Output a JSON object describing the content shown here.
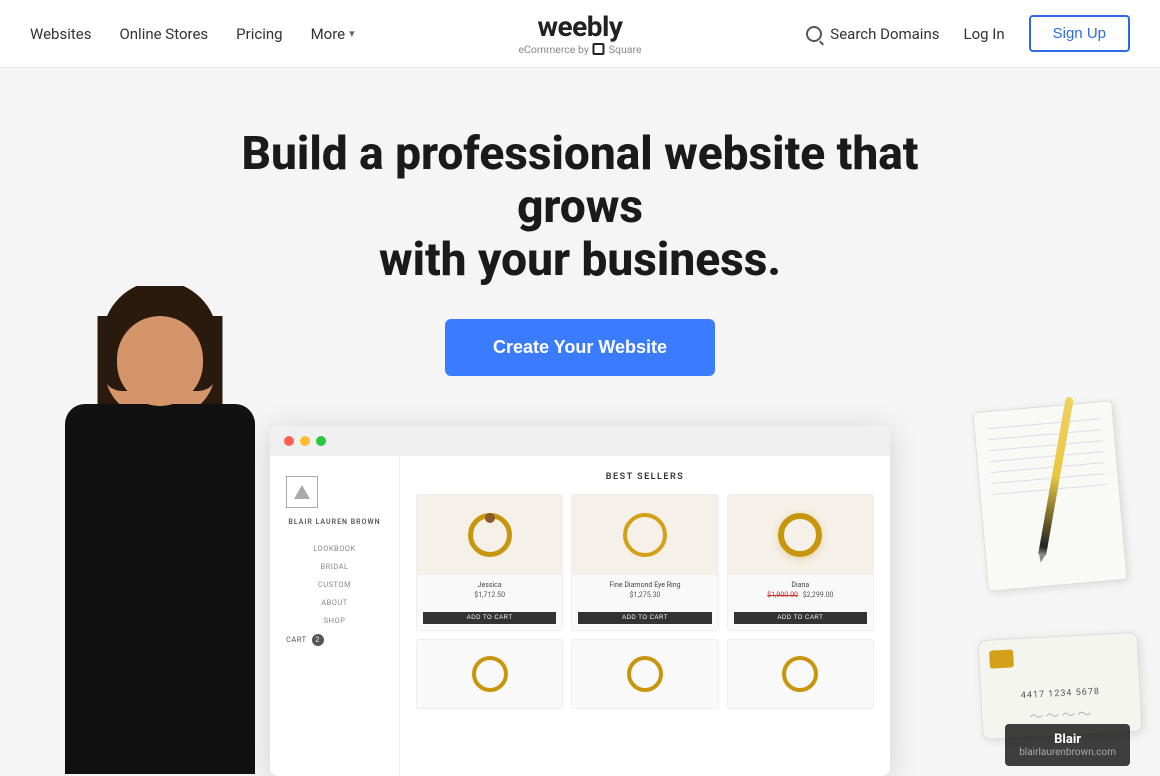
{
  "header": {
    "nav": {
      "websites": "Websites",
      "online_stores": "Online Stores",
      "pricing": "Pricing",
      "more": "More",
      "search_domains": "Search Domains",
      "login": "Log In",
      "signup": "Sign Up"
    },
    "logo": {
      "name": "weebly",
      "sub": "eCommerce by",
      "square": "Square"
    }
  },
  "hero": {
    "headline_line1": "Build a professional website that grows",
    "headline_line2": "with your business.",
    "cta": "Create Your Website"
  },
  "mockup": {
    "titlebar_dots": [
      "red",
      "yellow",
      "green"
    ],
    "sidebar": {
      "brand": "Blair Lauren Brown",
      "nav_items": [
        "Lookbook",
        "Bridal",
        "Custom",
        "About",
        "Shop"
      ],
      "cart": "Cart",
      "cart_count": "2"
    },
    "best_sellers_label": "Best Sellers",
    "products": [
      {
        "name": "Jessica",
        "price": "$1,712.50",
        "btn": "Add to Cart"
      },
      {
        "name": "Fine Diamond Eye Ring",
        "price": "$1,275.30",
        "btn": "Add to Cart"
      },
      {
        "name": "Diana",
        "price_old": "$1,900.00",
        "price": "$2,299.00",
        "btn": "Add to Cart"
      }
    ]
  },
  "blair_badge": {
    "name": "Blair",
    "url": "blairlaurenbrown.com"
  },
  "credit_card": {
    "number": "4417 1234 5678"
  }
}
